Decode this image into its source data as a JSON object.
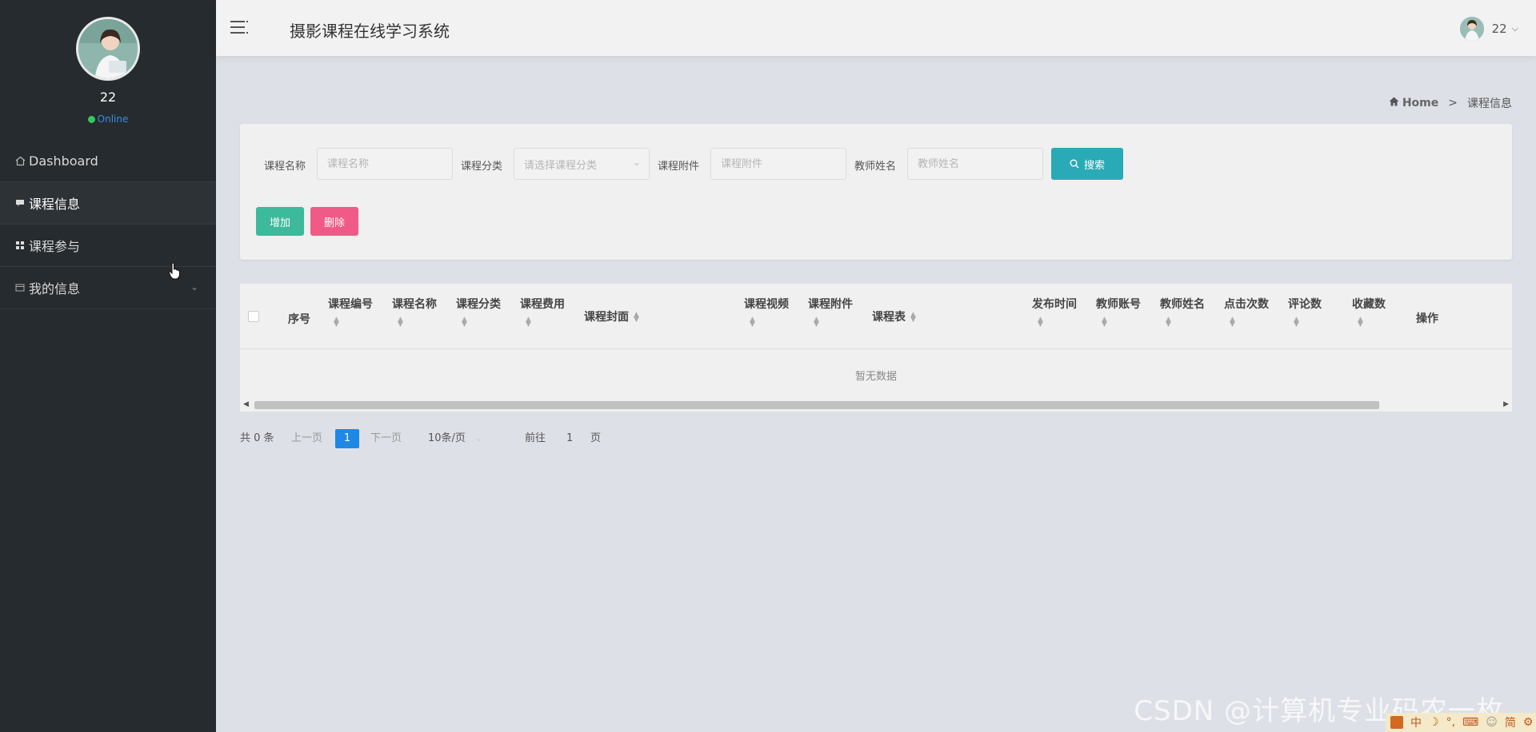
{
  "app": {
    "title": "摄影课程在线学习系统"
  },
  "sidebar": {
    "user": {
      "name": "22",
      "status": "Online"
    },
    "items": [
      {
        "label": "Dashboard",
        "icon": "home-icon",
        "active": false
      },
      {
        "label": "课程信息",
        "icon": "comment-icon",
        "active": true
      },
      {
        "label": "课程参与",
        "icon": "grid-icon",
        "active": false
      },
      {
        "label": "我的信息",
        "icon": "window-icon",
        "active": false
      }
    ]
  },
  "header": {
    "username": "22"
  },
  "breadcrumb": {
    "home": "Home",
    "separator": ">",
    "current": "课程信息"
  },
  "search": {
    "fields": [
      {
        "label": "课程名称",
        "placeholder": "课程名称"
      },
      {
        "label": "课程分类",
        "placeholder": "请选择课程分类"
      },
      {
        "label": "课程附件",
        "placeholder": "课程附件"
      },
      {
        "label": "教师姓名",
        "placeholder": "教师姓名"
      }
    ],
    "search_button": "搜索",
    "add_button": "增加",
    "delete_button": "删除"
  },
  "table": {
    "columns": [
      "序号",
      "课程编号",
      "课程名称",
      "课程分类",
      "课程费用",
      "课程封面",
      "课程视频",
      "课程附件",
      "课程表",
      "发布时间",
      "教师账号",
      "教师姓名",
      "点击次数",
      "评论数",
      "收藏数",
      "操作"
    ],
    "empty_text": "暂无数据"
  },
  "pagination": {
    "total": "共 0 条",
    "prev": "上一页",
    "current_page": "1",
    "next": "下一页",
    "page_size": "10条/页",
    "goto_label": "前往",
    "goto_value": "1",
    "goto_suffix": "页"
  },
  "watermark": "CSDN @计算机专业码农一枚",
  "tray": [
    "中",
    "简"
  ],
  "colors": {
    "sidebar": "#262b2f",
    "search": "#2aaab6",
    "add": "#3db99b",
    "delete": "#ef5b86",
    "pager_active": "#1e88e5",
    "online": "#34c759"
  }
}
